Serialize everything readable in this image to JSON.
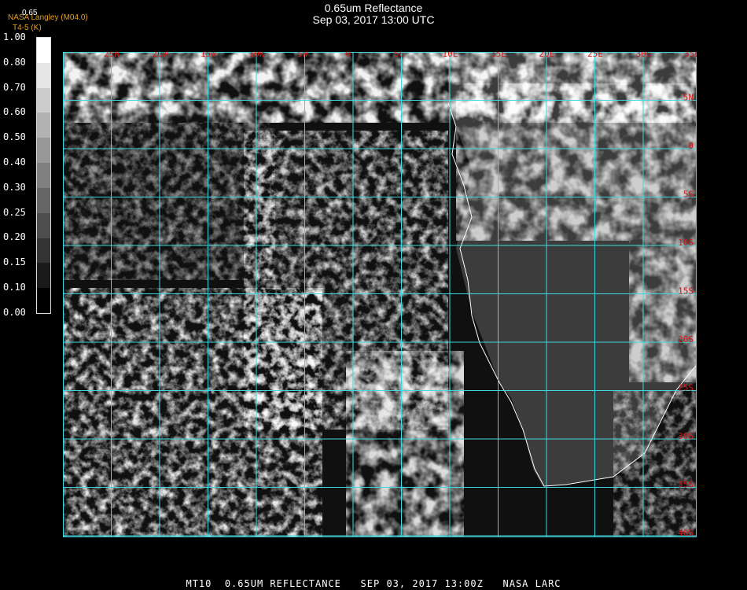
{
  "header": {
    "title": "0.65um Reflectance",
    "datetime": "Sep 03, 2017 13:00 UTC",
    "source": "NASA Langley (M04.0)",
    "subsource": "T4-5 (K)",
    "corner_label": "0.65"
  },
  "colorbar": {
    "ticks": [
      "1.00",
      "0.80",
      "0.70",
      "0.60",
      "0.50",
      "0.40",
      "0.30",
      "0.25",
      "0.20",
      "0.15",
      "0.10",
      "0.00"
    ]
  },
  "map": {
    "lon_labels": [
      "25W",
      "20W",
      "15W",
      "10W",
      "5W",
      "0",
      "5E",
      "10E",
      "15E",
      "20E",
      "25E",
      "30E",
      "35E"
    ],
    "lat_labels": [
      "5N",
      "0",
      "5S",
      "10S",
      "15S",
      "20S",
      "25S",
      "30S",
      "35S",
      "40S"
    ],
    "colors": {
      "grid": "#3fd8e0",
      "label": "#d01818",
      "coast": "#ffffff"
    }
  },
  "footer": {
    "caption": "MT10  0.65UM REFLECTANCE   SEP 03, 2017 13:00Z   NASA LARC"
  }
}
